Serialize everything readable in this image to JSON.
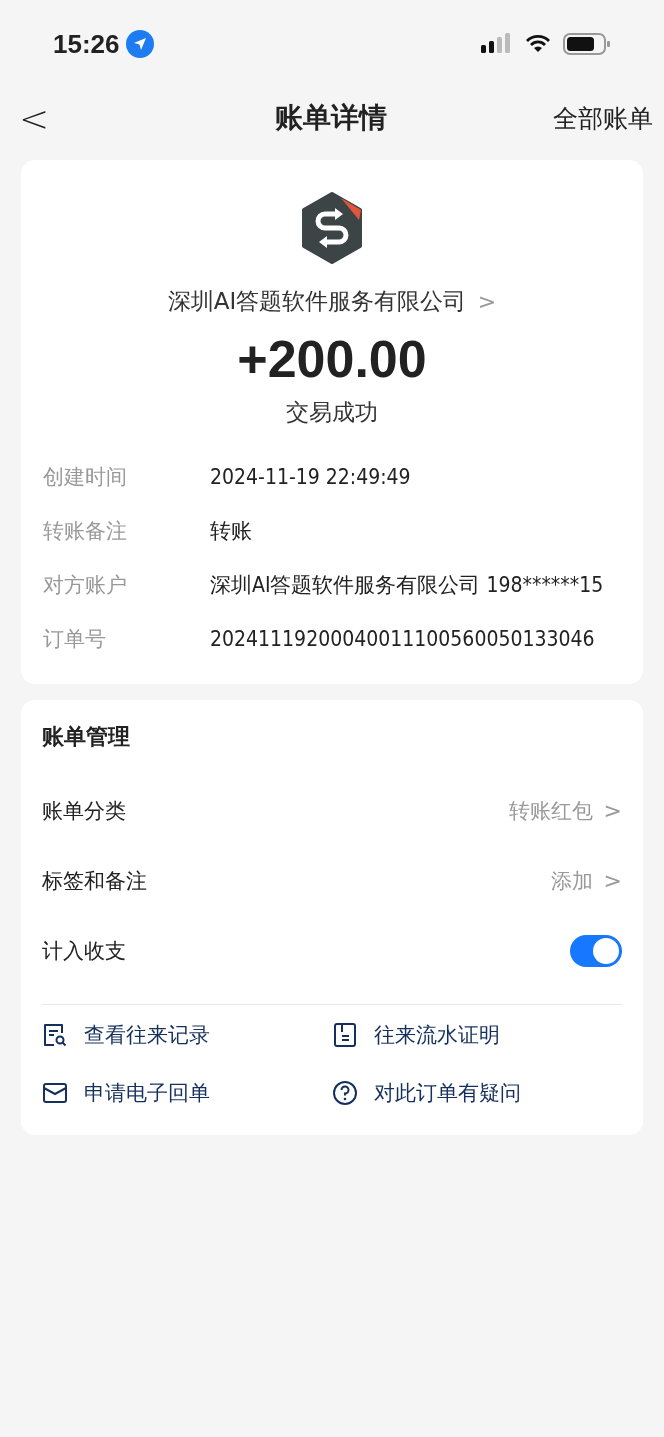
{
  "status_bar": {
    "time": "15:26"
  },
  "nav": {
    "back": "<",
    "title": "账单详情",
    "action": "全部账单"
  },
  "merchant": {
    "name": "深圳AI答题软件服务有限公司",
    "chevron": ">",
    "amount": "+200.00",
    "status": "交易成功"
  },
  "details": [
    {
      "label": "创建时间",
      "value": "2024-11-19 22:49:49"
    },
    {
      "label": "转账备注",
      "value": "转账"
    },
    {
      "label": "对方账户",
      "value": "深圳AI答题软件服务有限公司 198******15"
    },
    {
      "label": "订单号",
      "value": "20241119200040011100560050133046"
    }
  ],
  "management": {
    "title": "账单管理",
    "rows": [
      {
        "kind": "link",
        "label": "账单分类",
        "value": "转账红包",
        "chevron": ">"
      },
      {
        "kind": "link",
        "label": "标签和备注",
        "value": "添加",
        "chevron": ">"
      },
      {
        "kind": "toggle",
        "label": "计入收支",
        "on": true
      }
    ],
    "actions": [
      {
        "kind": "records",
        "label": "查看往来记录"
      },
      {
        "kind": "statement",
        "label": "往来流水证明"
      },
      {
        "kind": "receipt",
        "label": "申请电子回单"
      },
      {
        "kind": "question",
        "label": "对此订单有疑问"
      }
    ]
  }
}
